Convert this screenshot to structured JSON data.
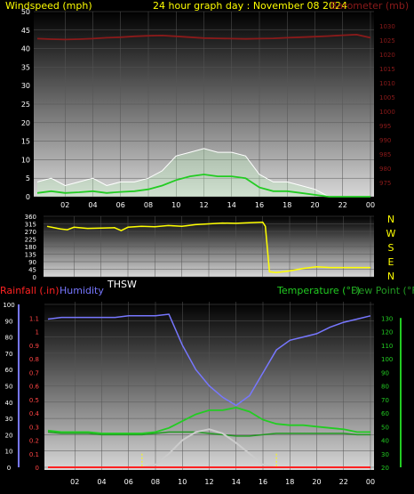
{
  "header": {
    "left_label": "Windspeed (mph)",
    "center_label": "24 hour graph day : November 08 2024",
    "right_label": "Barometer (mb)"
  },
  "colors": {
    "background": "#000000",
    "wind": "#ffffff",
    "wind_avg": "#22cc22",
    "wind_fill": "#bff0bf",
    "barometer": "#8b1a1a",
    "direction": "#ffff00",
    "humidity": "#7777ff",
    "temperature": "#22cc22",
    "dew_point": "#229922",
    "solar": "#cccccc",
    "rainfall": "#ff2222",
    "label_yellow": "#ffff00"
  },
  "chart_data": [
    {
      "type": "line",
      "name": "wind-barometer",
      "x_ticks": [
        "02",
        "04",
        "06",
        "08",
        "10",
        "12",
        "14",
        "16",
        "18",
        "20",
        "22",
        "00"
      ],
      "ylabel": "Windspeed (mph)",
      "ylim": [
        0,
        50
      ],
      "y_ticks": [
        0,
        5,
        10,
        15,
        20,
        25,
        30,
        35,
        40,
        45,
        50
      ],
      "y2label": "Barometer (mb)",
      "y2lim": [
        970,
        1035
      ],
      "y2_ticks": [
        975,
        980,
        985,
        990,
        995,
        1000,
        1005,
        1010,
        1015,
        1020,
        1025,
        1030
      ],
      "hours": [
        0,
        1,
        2,
        3,
        4,
        5,
        6,
        7,
        8,
        9,
        10,
        11,
        12,
        13,
        14,
        15,
        16,
        17,
        18,
        19,
        20,
        21,
        22,
        23,
        24
      ],
      "series": [
        {
          "name": "Barometer",
          "values": [
            1025.5,
            1025.3,
            1025.2,
            1025.3,
            1025.5,
            1025.8,
            1026.0,
            1026.3,
            1026.5,
            1026.6,
            1026.3,
            1026.0,
            1025.7,
            1025.6,
            1025.5,
            1025.4,
            1025.5,
            1025.6,
            1025.8,
            1026.0,
            1026.2,
            1026.4,
            1026.7,
            1026.9,
            1025.8
          ]
        },
        {
          "name": "Wind gust",
          "values": [
            4,
            5,
            3,
            4,
            5,
            3,
            4,
            4,
            5,
            7,
            11,
            12,
            13,
            12,
            12,
            11,
            6,
            4,
            4,
            3,
            2,
            0,
            0,
            0,
            0
          ]
        },
        {
          "name": "Wind average",
          "values": [
            1,
            1.5,
            1,
            1.2,
            1.5,
            1,
            1.3,
            1.5,
            2,
            3,
            4.5,
            5.5,
            6,
            5.5,
            5.5,
            5,
            2.5,
            1.5,
            1.5,
            1,
            0.5,
            0,
            0,
            0,
            0
          ]
        }
      ]
    },
    {
      "type": "line",
      "name": "wind-direction",
      "ylabel": "THSW",
      "ylim": [
        0,
        360
      ],
      "y_ticks": [
        0,
        45,
        90,
        135,
        180,
        225,
        270,
        315,
        360
      ],
      "compass": [
        "N",
        "W",
        "S",
        "E",
        "N"
      ],
      "hours": [
        0,
        1,
        1.5,
        2,
        3,
        4,
        5,
        5.5,
        6,
        7,
        8,
        9,
        10,
        11,
        12,
        13,
        14,
        15,
        16,
        16.2,
        16.5,
        17,
        18,
        19,
        20,
        21,
        22,
        23,
        24
      ],
      "series": [
        {
          "name": "Direction",
          "values": [
            300,
            285,
            280,
            295,
            288,
            290,
            292,
            275,
            295,
            300,
            298,
            305,
            300,
            310,
            315,
            320,
            318,
            322,
            325,
            300,
            30,
            25,
            35,
            50,
            60,
            55,
            55,
            55,
            55
          ]
        }
      ]
    },
    {
      "type": "line",
      "name": "temperature-humidity",
      "labels": {
        "rainfall": "Rainfall (.in)",
        "humidity": "Humidity",
        "temperature": "Temperature (°F)",
        "dew_point": "Dew Point (°F)"
      },
      "humidity_ticks": [
        0,
        10,
        20,
        30,
        40,
        50,
        60,
        70,
        80,
        90,
        100
      ],
      "rain_ticks": [
        "0",
        "0.1",
        "0.2",
        "0.3",
        "0.4",
        "0.5",
        "0.6",
        "0.7",
        "0.8",
        "0.9",
        "1",
        "1.1"
      ],
      "temp_ticks": [
        20,
        30,
        40,
        50,
        60,
        70,
        80,
        90,
        100,
        110,
        120,
        130
      ],
      "ylim_humidity": [
        0,
        100
      ],
      "ylim_temp": [
        20,
        140
      ],
      "hours": [
        0,
        1,
        2,
        3,
        4,
        5,
        6,
        7,
        8,
        9,
        10,
        11,
        12,
        13,
        14,
        15,
        16,
        17,
        18,
        19,
        20,
        21,
        22,
        23,
        24
      ],
      "series": [
        {
          "name": "Humidity",
          "values": [
            91,
            92,
            92,
            92,
            92,
            92,
            93,
            93,
            93,
            94,
            75,
            60,
            50,
            43,
            38,
            44,
            58,
            72,
            78,
            80,
            82,
            86,
            89,
            91,
            93
          ]
        },
        {
          "name": "Temperature",
          "values": [
            47,
            46,
            46,
            46,
            45,
            45,
            45,
            45,
            46,
            49,
            54,
            59,
            62,
            62,
            64,
            61,
            55,
            52,
            51,
            51,
            50,
            49,
            48,
            46,
            46
          ]
        },
        {
          "name": "Dew Point",
          "values": [
            46,
            45,
            45,
            45,
            44,
            44,
            44,
            44,
            45,
            46,
            46,
            46,
            45,
            44,
            43,
            43,
            44,
            45,
            45,
            45,
            45,
            45,
            45,
            44,
            44
          ]
        },
        {
          "name": "Solar",
          "values": [
            0,
            0,
            0,
            0,
            0,
            0,
            0,
            0,
            0.02,
            0.1,
            0.2,
            0.26,
            0.28,
            0.25,
            0.18,
            0.1,
            0.02,
            0,
            0,
            0,
            0,
            0,
            0,
            0,
            0
          ]
        },
        {
          "name": "Rainfall",
          "values": [
            0,
            0,
            0,
            0,
            0,
            0,
            0,
            0,
            0,
            0,
            0,
            0,
            0,
            0,
            0,
            0,
            0,
            0,
            0,
            0,
            0,
            0,
            0,
            0,
            0
          ]
        }
      ]
    }
  ]
}
